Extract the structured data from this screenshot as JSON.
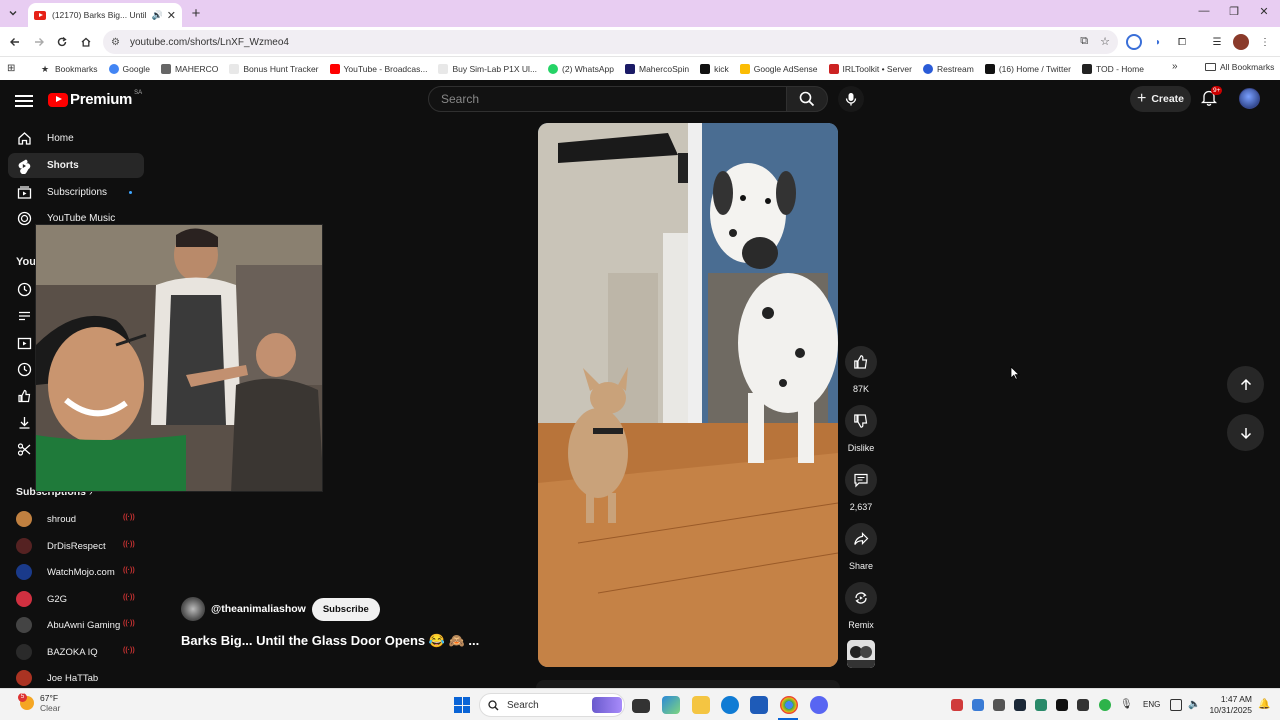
{
  "browser": {
    "tab_title": "(12170) Barks Big... Until th",
    "url": "youtube.com/shorts/LnXF_Wzmeo4",
    "bookmarks": [
      {
        "label": "Bookmarks",
        "color": "#333333"
      },
      {
        "label": "Google",
        "color": "#4285f4"
      },
      {
        "label": "MAHERCO",
        "color": "#666666"
      },
      {
        "label": "Bonus Hunt Tracker",
        "color": "#e8e8e8"
      },
      {
        "label": "YouTube - Broadcas...",
        "color": "#ff0000"
      },
      {
        "label": "Buy Sim-Lab P1X Ul...",
        "color": "#e8e8e8"
      },
      {
        "label": "(2) WhatsApp",
        "color": "#25d366"
      },
      {
        "label": "MahercoSpin",
        "color": "#1a1a66"
      },
      {
        "label": "kick",
        "color": "#111111"
      },
      {
        "label": "Google AdSense",
        "color": "#fbbc04"
      },
      {
        "label": "IRLToolkit • Server",
        "color": "#cc2222"
      },
      {
        "label": "Restream",
        "color": "#2a5bd7"
      },
      {
        "label": "(16) Home / Twitter",
        "color": "#111111"
      },
      {
        "label": "TOD - Home",
        "color": "#222222"
      }
    ],
    "all_bookmarks": "All Bookmarks"
  },
  "youtube": {
    "logo_text": "Premium",
    "country_code": "SA",
    "search_placeholder": "Search",
    "create_label": "Create",
    "notification_count": "9+",
    "sidebar": {
      "items": [
        {
          "label": "Home"
        },
        {
          "label": "Shorts"
        },
        {
          "label": "Subscriptions"
        },
        {
          "label": "YouTube Music"
        }
      ],
      "you_label": "You",
      "subscriptions_label": "Subscriptions",
      "subscriptions": [
        {
          "name": "shroud",
          "color": "#c08040"
        },
        {
          "name": "DrDisRespect",
          "color": "#552222"
        },
        {
          "name": "WatchMojo.com",
          "color": "#1a3a8a"
        },
        {
          "name": "G2G",
          "color": "#d03040"
        },
        {
          "name": "AbuAwni Gaming",
          "color": "#444444"
        },
        {
          "name": "BAZOKA IQ",
          "color": "#2a2a2a"
        },
        {
          "name": "Joe HaTTab",
          "color": "#aa3322"
        }
      ]
    },
    "short": {
      "channel": "@theanimaliashow",
      "subscribe_label": "Subscribe",
      "title": "Barks Big... Until the Glass Door Opens 😂 🙈 ...",
      "likes": "87K",
      "dislike_label": "Dislike",
      "comments": "2,637",
      "share_label": "Share",
      "remix_label": "Remix"
    }
  },
  "taskbar": {
    "weather_temp": "67°F",
    "weather_desc": "Clear",
    "weather_badge": "5",
    "search_label": "Search",
    "language": "ENG",
    "time": "1:47 AM",
    "date": "10/31/2025"
  }
}
